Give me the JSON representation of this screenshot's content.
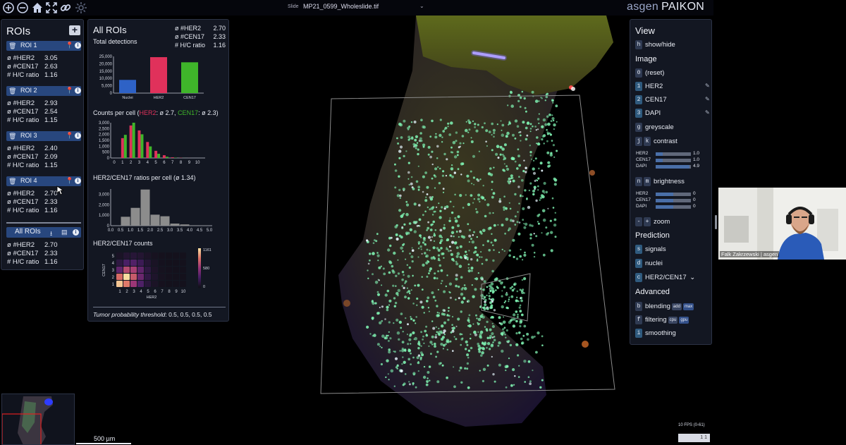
{
  "toolbar": {
    "icons": [
      "zoom-in-icon",
      "zoom-out-icon",
      "home-icon",
      "fullscreen-icon",
      "link-icon",
      "settings-icon"
    ],
    "slide_label": "Slide",
    "slide_name": "MP21_0599_Wholeslide.tif",
    "brand_left": "asgen",
    "brand_right": "PAIKON"
  },
  "rois": {
    "title": "ROIs",
    "add_label": "+",
    "items": [
      {
        "name": "ROI 1",
        "her2_label": "ø #HER2",
        "her2": "3.05",
        "cen17_label": "ø #CEN17",
        "cen17": "2.63",
        "ratio_label": "# H/C ratio",
        "ratio": "1.16"
      },
      {
        "name": "ROI 2",
        "her2_label": "ø #HER2",
        "her2": "2.93",
        "cen17_label": "ø #CEN17",
        "cen17": "2.54",
        "ratio_label": "# H/C ratio",
        "ratio": "1.15"
      },
      {
        "name": "ROI 3",
        "her2_label": "ø #HER2",
        "her2": "2.40",
        "cen17_label": "ø #CEN17",
        "cen17": "2.09",
        "ratio_label": "# H/C ratio",
        "ratio": "1.15"
      },
      {
        "name": "ROI 4",
        "her2_label": "ø #HER2",
        "her2": "2.70",
        "cen17_label": "ø #CEN17",
        "cen17": "2.33",
        "ratio_label": "# H/C ratio",
        "ratio": "1.16"
      }
    ],
    "all": {
      "name": "All ROIs",
      "her2_label": "ø #HER2",
      "her2": "2.70",
      "cen17_label": "ø #CEN17",
      "cen17": "2.33",
      "ratio_label": "# H/C ratio",
      "ratio": "1.16"
    }
  },
  "stats": {
    "title": "All ROIs",
    "subtitle": "Total detections",
    "summary": [
      {
        "label": "ø #HER2",
        "value": "2.70"
      },
      {
        "label": "ø #CEN17",
        "value": "2.33"
      },
      {
        "label": "# H/C ratio",
        "value": "1.16"
      }
    ],
    "counts_head_pre": "Counts per cell (",
    "counts_head_her2": "HER2",
    "counts_head_her2_val": ": ø 2.7, ",
    "counts_head_cen17": "CEN17",
    "counts_head_cen17_val": ": ø 2.3)",
    "ratio_head": "HER2/CEN17 ratios per cell (ø 1.34)",
    "heat_head": "HER2/CEN17 counts",
    "footer_label": "Tumor probability threshold",
    "footer_value": ": 0.5, 0.5, 0.5, 0.5"
  },
  "view": {
    "title": "View",
    "show_hide": {
      "key": "h",
      "label": "show/hide"
    },
    "image_head": "Image",
    "reset": {
      "key": "0",
      "label": "(reset)"
    },
    "channels": [
      {
        "key": "1",
        "label": "HER2"
      },
      {
        "key": "2",
        "label": "CEN17"
      },
      {
        "key": "3",
        "label": "DAPI"
      }
    ],
    "greyscale": {
      "key": "g",
      "label": "greyscale"
    },
    "contrast": {
      "key1": "j",
      "key2": "k",
      "label": "contrast"
    },
    "contrast_sliders": [
      {
        "name": "HER2",
        "value": "1.0",
        "level": 0.2
      },
      {
        "name": "CEN17",
        "value": "1.0",
        "level": 0.2
      },
      {
        "name": "DAPI",
        "value": "4.9",
        "level": 0.96
      }
    ],
    "brightness": {
      "key1": "n",
      "key2": "m",
      "label": "brightness"
    },
    "brightness_sliders": [
      {
        "name": "HER2",
        "value": "0",
        "level": 0.5
      },
      {
        "name": "CEN17",
        "value": "0",
        "level": 0.5
      },
      {
        "name": "DAPI",
        "value": "0",
        "level": 0.5
      }
    ],
    "zoom": {
      "key1": "-",
      "key2": "+",
      "label": "zoom"
    },
    "prediction_head": "Prediction",
    "signals": {
      "key": "s",
      "label": "signals"
    },
    "nuclei": {
      "key": "d",
      "label": "nuclei"
    },
    "her2cen17": {
      "key": "c",
      "label": "HER2/CEN17",
      "chevron": "⌄"
    },
    "advanced_head": "Advanced",
    "blending": {
      "key": "b",
      "label": "blending",
      "opt1": "add",
      "opt2": "max"
    },
    "filtering": {
      "key": "f",
      "label": "filtering",
      "opt1": "cpu",
      "opt2": "gpu"
    },
    "smoothing": {
      "key": "i",
      "label": "smoothing"
    }
  },
  "scalebar": "500 µm",
  "fps": "10 FPS (0-61)",
  "fps_box": "1  1",
  "webcam_name": "Falk Zakrzewski | asgen",
  "chart_data": [
    {
      "type": "bar",
      "title": "Total detections",
      "categories": [
        "Nuclei",
        "HER2",
        "CEN17"
      ],
      "values": [
        9000,
        24500,
        21000
      ],
      "colors": [
        "#2e62c6",
        "#e0315b",
        "#3fb52a"
      ],
      "yticks": [
        "0",
        "5,000",
        "10,000",
        "15,000",
        "20,000",
        "25,000"
      ],
      "ylim": [
        0,
        25000
      ]
    },
    {
      "type": "bar",
      "title": "Counts per cell",
      "categories": [
        "0",
        "1",
        "2",
        "3",
        "4",
        "5",
        "6",
        "7",
        "8",
        "9",
        "10"
      ],
      "series": [
        {
          "name": "HER2",
          "color": "#e0315b",
          "values": [
            0,
            1800,
            2950,
            2500,
            1450,
            650,
            250,
            60,
            20,
            5,
            0
          ]
        },
        {
          "name": "CEN17",
          "color": "#3fb52a",
          "values": [
            0,
            2100,
            3200,
            2150,
            1050,
            380,
            110,
            30,
            5,
            0,
            0
          ]
        }
      ],
      "yticks": [
        "0",
        "500",
        "1,000",
        "1,500",
        "2,000",
        "2,500",
        "3,000"
      ],
      "xticks": [
        "0",
        "1",
        "2",
        "3",
        "4",
        "5",
        "6",
        "7",
        "8",
        "9",
        "10"
      ],
      "ylim": [
        0,
        3200
      ]
    },
    {
      "type": "bar",
      "title": "HER2/CEN17 ratios per cell",
      "x": [
        0.5,
        1.0,
        1.5,
        2.0,
        2.5,
        3.0,
        3.5,
        4.0,
        4.5
      ],
      "values": [
        850,
        1700,
        3450,
        1050,
        900,
        200,
        120,
        40,
        15
      ],
      "color": "#8c8c8c",
      "yticks": [
        "0",
        "1,000",
        "2,000",
        "3,000"
      ],
      "xticks": [
        "0.0",
        "0.5",
        "1.0",
        "1.5",
        "2.0",
        "2.5",
        "3.0",
        "3.5",
        "4.0",
        "4.5",
        "5.0"
      ],
      "ylim": [
        0,
        3500
      ]
    },
    {
      "type": "heatmap",
      "title": "HER2/CEN17 counts",
      "xlabel": "HER2",
      "ylabel": "CEN17",
      "xticks": [
        "1",
        "2",
        "3",
        "4",
        "5",
        "6",
        "7",
        "8",
        "9",
        "10"
      ],
      "yticks": [
        "1",
        "2",
        "3",
        "4",
        "5"
      ],
      "colorbar_ticks": [
        "1161",
        "580",
        "0"
      ],
      "zmax": 1161,
      "rows": [
        [
          1100,
          900,
          600,
          320,
          120,
          40,
          10,
          0,
          0,
          0
        ],
        [
          850,
          1161,
          780,
          420,
          160,
          60,
          15,
          5,
          0,
          0
        ],
        [
          380,
          700,
          650,
          380,
          150,
          50,
          12,
          4,
          0,
          0
        ],
        [
          150,
          300,
          330,
          230,
          100,
          35,
          8,
          0,
          0,
          0
        ],
        [
          40,
          90,
          110,
          90,
          45,
          15,
          3,
          0,
          0,
          0
        ]
      ]
    }
  ]
}
